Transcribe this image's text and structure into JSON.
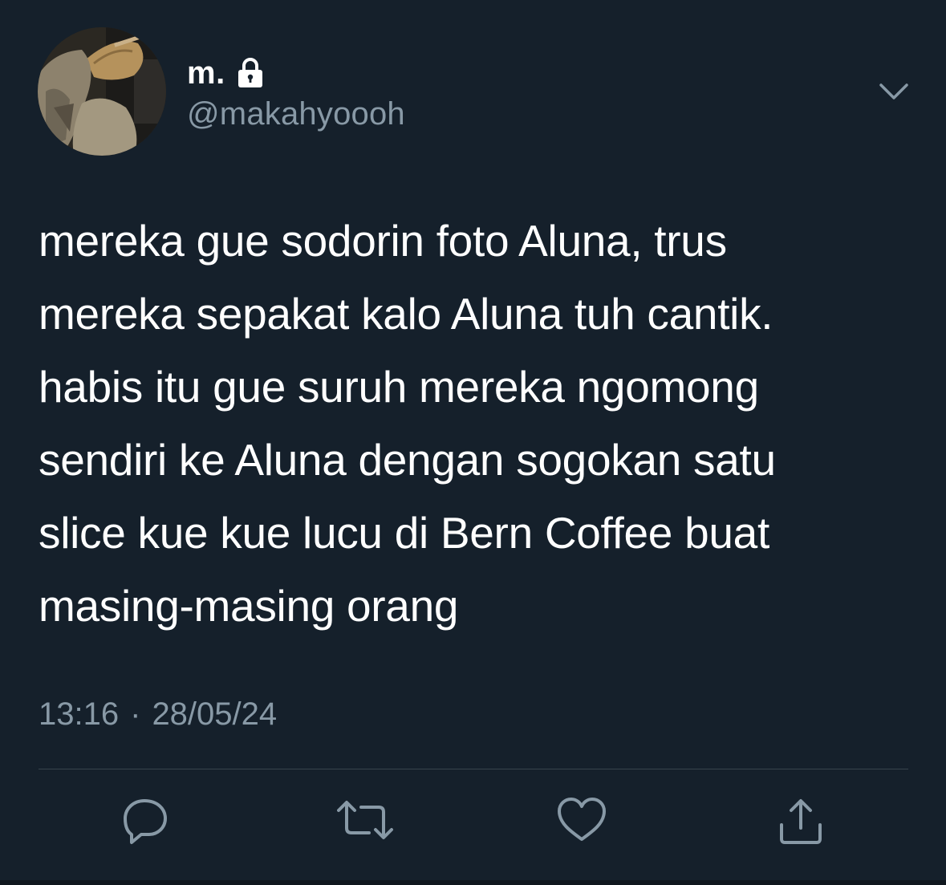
{
  "user": {
    "display_name": "m.",
    "handle": "@makahyoooh",
    "protected_icon": "lock-icon",
    "avatar_icon": "avatar-photo"
  },
  "tweet": {
    "text": "mereka gue sodorin foto Aluna, trus\nmereka sepakat kalo Aluna tuh cantik.\nhabis itu gue suruh mereka ngomong\nsendiri ke Aluna dengan sogokan satu\nslice kue kue lucu di Bern Coffee buat\nmasing-masing orang",
    "time": "13:16",
    "separator": "·",
    "date": "28/05/24"
  },
  "actions": {
    "reply_icon": "reply-icon",
    "retweet_icon": "retweet-icon",
    "like_icon": "heart-icon",
    "share_icon": "share-icon",
    "menu_icon": "chevron-down-icon"
  },
  "colors": {
    "background": "#15202b",
    "text_primary": "#ffffff",
    "text_secondary": "#8899a6",
    "divider": "#38444d"
  }
}
